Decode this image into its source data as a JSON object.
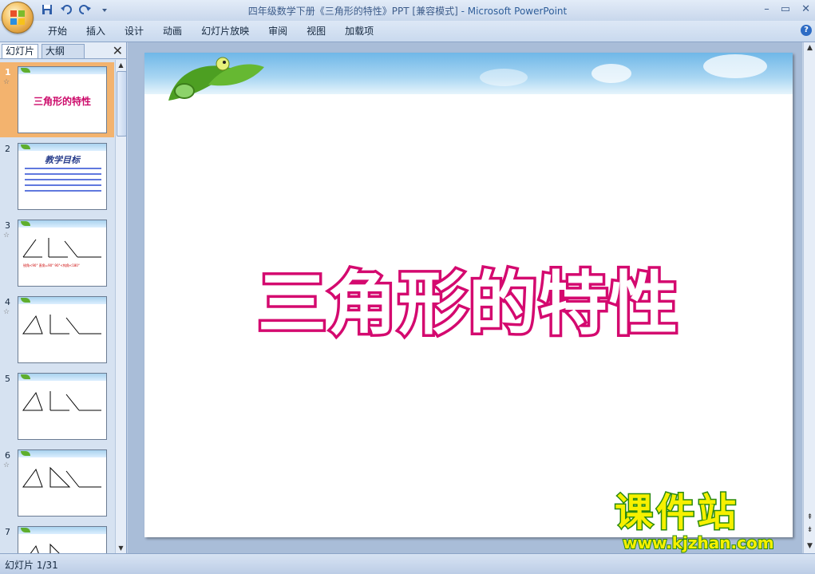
{
  "window": {
    "title": "四年级数学下册《三角形的特性》PPT [兼容模式]",
    "app_suffix": " - Microsoft PowerPoint",
    "minimize": "–",
    "restore": "▭",
    "close": "✕"
  },
  "quick_access": [
    "save-icon",
    "undo-icon",
    "redo-icon",
    "customize-icon"
  ],
  "ribbon": {
    "tabs": [
      "开始",
      "插入",
      "设计",
      "动画",
      "幻灯片放映",
      "审阅",
      "视图",
      "加载项"
    ],
    "help": "?"
  },
  "panel": {
    "tab_slides": "幻灯片",
    "tab_outline": "大纲",
    "close": "✕",
    "thumbnails": [
      {
        "num": "1",
        "star": "☆",
        "title": "三角形的特性",
        "selected": true
      },
      {
        "num": "2",
        "star": "",
        "heading": "教学目标"
      },
      {
        "num": "3",
        "star": "☆",
        "caption": "锐角<90°   直角=90°  90°<钝角<180°"
      },
      {
        "num": "4",
        "star": "☆"
      },
      {
        "num": "5",
        "star": ""
      },
      {
        "num": "6",
        "star": "☆"
      },
      {
        "num": "7",
        "star": ""
      }
    ]
  },
  "slide": {
    "title": "三角形的特性"
  },
  "watermark": {
    "brand": "课件站",
    "url": "www.kjzhan.com"
  },
  "status": {
    "slide_counter": "幻灯片 1/31"
  },
  "colors": {
    "title_stroke": "#d4096f",
    "selected_thumb": "#f3b36e",
    "watermark_fill": "#f6f000"
  }
}
